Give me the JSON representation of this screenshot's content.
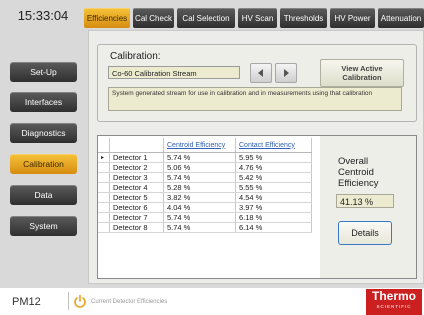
{
  "time": "15:33:04",
  "sidebar": {
    "items": [
      {
        "label": "Set-Up",
        "active": false
      },
      {
        "label": "Interfaces",
        "active": false
      },
      {
        "label": "Diagnostics",
        "active": false
      },
      {
        "label": "Calibration",
        "active": true
      },
      {
        "label": "Data",
        "active": false
      },
      {
        "label": "System",
        "active": false
      }
    ]
  },
  "tabs": [
    {
      "label": "Efficiencies",
      "active": true
    },
    {
      "label": "Cal Check",
      "active": false
    },
    {
      "label": "Cal Selection",
      "active": false
    },
    {
      "label": "HV Scan",
      "active": false
    },
    {
      "label": "Thresholds",
      "active": false
    },
    {
      "label": "HV Power",
      "active": false
    },
    {
      "label": "Attenuation",
      "active": false
    }
  ],
  "calibration": {
    "title": "Calibration:",
    "selected": "Co-60 Calibration Stream",
    "view_active_label": "View Active Calibration",
    "description": "System generated stream for use in calibration and in measurements using that calibration"
  },
  "table": {
    "headers": [
      "",
      "Centroid Efficiency",
      "Contact Efficiency"
    ],
    "rows": [
      {
        "marker": "▸",
        "detector": "Detector 1",
        "centroid": "5.74 %",
        "contact": "5.95 %"
      },
      {
        "marker": "",
        "detector": "Detector 2",
        "centroid": "5.06 %",
        "contact": "4.76 %"
      },
      {
        "marker": "",
        "detector": "Detector 3",
        "centroid": "5.74 %",
        "contact": "5.42 %"
      },
      {
        "marker": "",
        "detector": "Detector 4",
        "centroid": "5.28 %",
        "contact": "5.55 %"
      },
      {
        "marker": "",
        "detector": "Detector 5",
        "centroid": "3.82 %",
        "contact": "4.54 %"
      },
      {
        "marker": "",
        "detector": "Detector 6",
        "centroid": "4.04 %",
        "contact": "3.97 %"
      },
      {
        "marker": "",
        "detector": "Detector 7",
        "centroid": "5.74 %",
        "contact": "6.18 %"
      },
      {
        "marker": "",
        "detector": "Detector 8",
        "centroid": "5.74 %",
        "contact": "6.14 %"
      }
    ]
  },
  "overall": {
    "label_lines": [
      "Overall",
      "Centroid",
      "Efficiency"
    ],
    "value": "41.13 %",
    "details_label": "Details"
  },
  "footer": {
    "device": "PM12",
    "status": "Current Detector Efficiencies",
    "logo_main": "Thermo",
    "logo_sub": "SCIENTIFIC"
  },
  "colors": {
    "accent_active": "#f0b02a",
    "button_dark": "#3a3a3a",
    "brand_red": "#cc1f1f",
    "link_blue": "#3060b8"
  },
  "icons": {
    "prev": "chevron-left-icon",
    "next": "chevron-right-icon",
    "status": "power-icon"
  }
}
